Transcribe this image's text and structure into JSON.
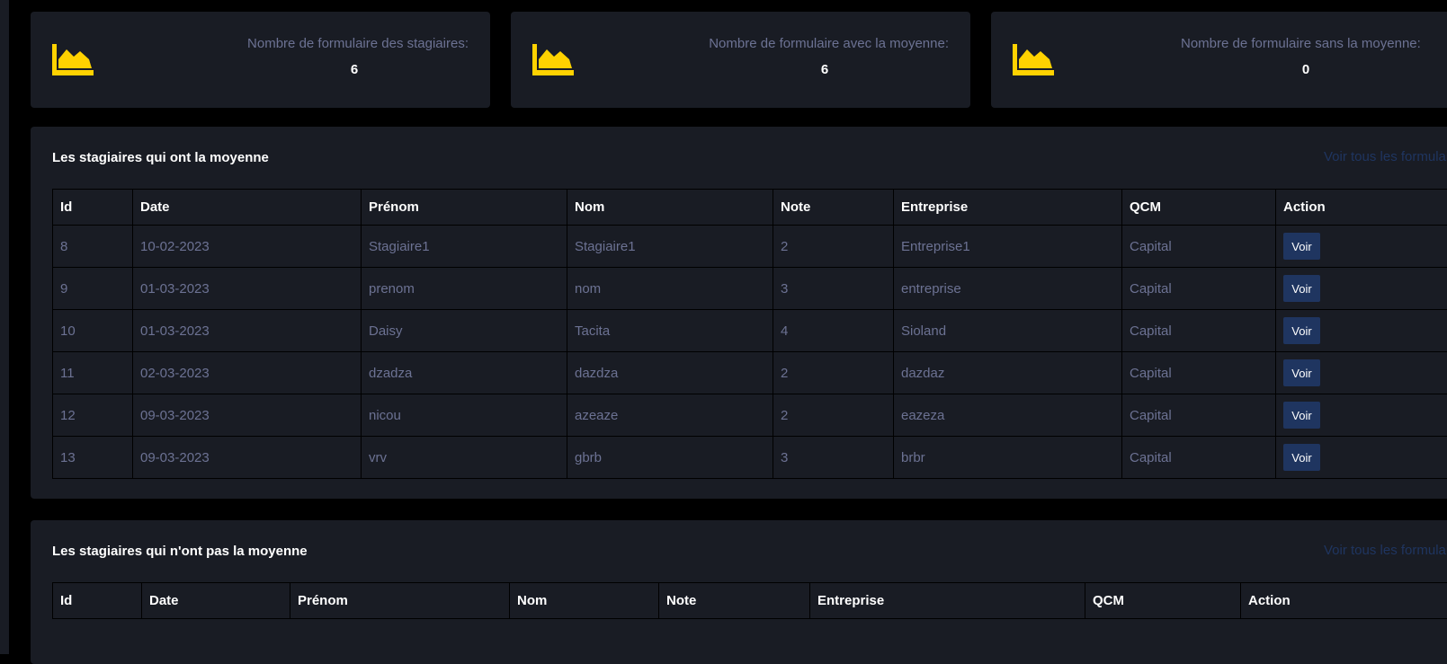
{
  "colors": {
    "accent_icon": "#ffd200",
    "card_bg": "#191c24",
    "muted_text": "#6c7293",
    "button_bg": "#1f3560"
  },
  "stats": [
    {
      "label": "Nombre de formulaire des stagiaires:",
      "value": "6",
      "icon": "area-chart-icon"
    },
    {
      "label": "Nombre de formulaire avec la moyenne:",
      "value": "6",
      "icon": "area-chart-icon"
    },
    {
      "label": "Nombre de formulaire sans la moyenne:",
      "value": "0",
      "icon": "area-chart-icon"
    }
  ],
  "with_average": {
    "title": "Les stagiaires qui ont la moyenne",
    "link": "Voir tous les formulaires",
    "columns": [
      "Id",
      "Date",
      "Prénom",
      "Nom",
      "Note",
      "Entreprise",
      "QCM",
      "Action"
    ],
    "rows": [
      {
        "id": "8",
        "date": "10-02-2023",
        "prenom": "Stagiaire1",
        "nom": "Stagiaire1",
        "note": "2",
        "entreprise": "Entreprise1",
        "qcm": "Capital",
        "action": "Voir"
      },
      {
        "id": "9",
        "date": "01-03-2023",
        "prenom": "prenom",
        "nom": "nom",
        "note": "3",
        "entreprise": "entreprise",
        "qcm": "Capital",
        "action": "Voir"
      },
      {
        "id": "10",
        "date": "01-03-2023",
        "prenom": "Daisy",
        "nom": "Tacita",
        "note": "4",
        "entreprise": "Sioland",
        "qcm": "Capital",
        "action": "Voir"
      },
      {
        "id": "11",
        "date": "02-03-2023",
        "prenom": "dzadza",
        "nom": "dazdza",
        "note": "2",
        "entreprise": "dazdaz",
        "qcm": "Capital",
        "action": "Voir"
      },
      {
        "id": "12",
        "date": "09-03-2023",
        "prenom": "nicou",
        "nom": "azeaze",
        "note": "2",
        "entreprise": "eazeza",
        "qcm": "Capital",
        "action": "Voir"
      },
      {
        "id": "13",
        "date": "09-03-2023",
        "prenom": "vrv",
        "nom": "gbrb",
        "note": "3",
        "entreprise": "brbr",
        "qcm": "Capital",
        "action": "Voir"
      }
    ]
  },
  "without_average": {
    "title": "Les stagiaires qui n'ont pas la moyenne",
    "link": "Voir tous les formulaires",
    "columns": [
      "Id",
      "Date",
      "Prénom",
      "Nom",
      "Note",
      "Entreprise",
      "QCM",
      "Action"
    ]
  }
}
